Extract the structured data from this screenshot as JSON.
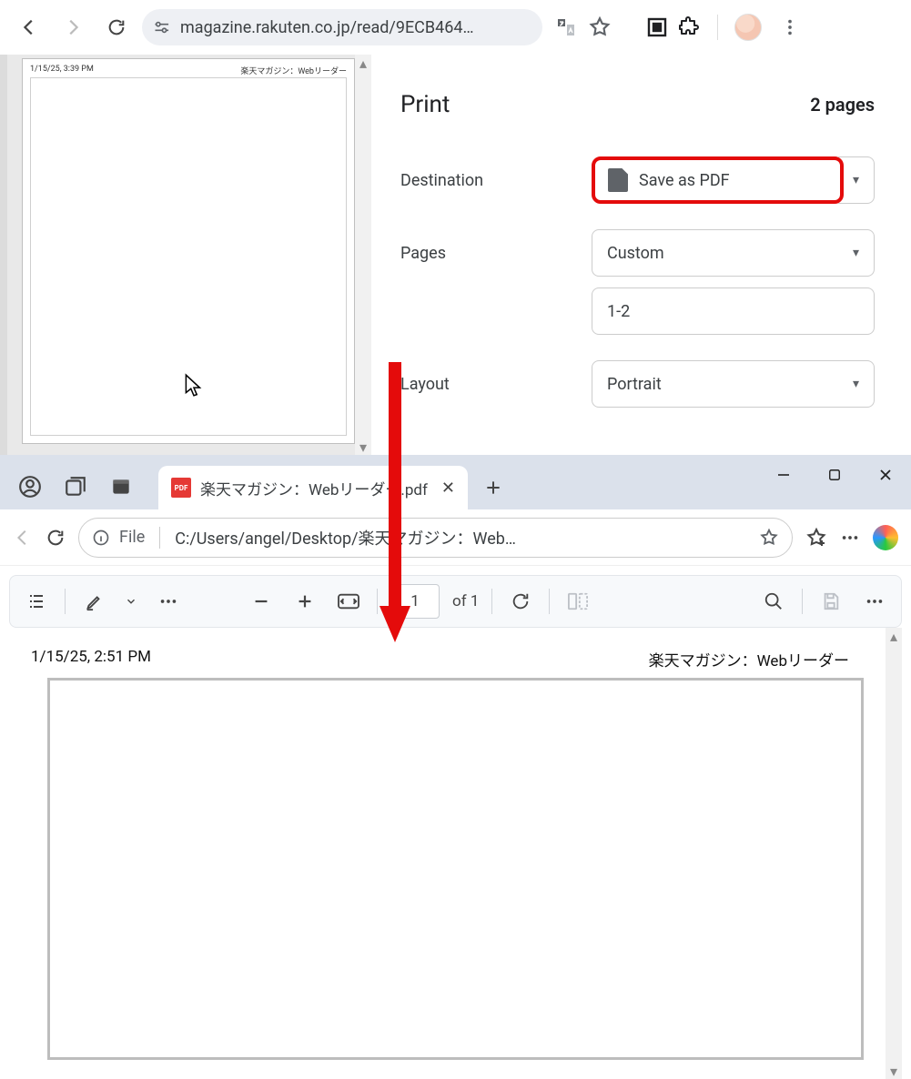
{
  "chrome": {
    "url": "magazine.rakuten.co.jp/read/9ECB464…",
    "preview": {
      "timestamp": "1/15/25, 3:39 PM",
      "title": "楽天マガジン：Webリーダー"
    },
    "print": {
      "title": "Print",
      "page_count": "2 pages",
      "destination_label": "Destination",
      "destination_value": "Save as PDF",
      "pages_label": "Pages",
      "pages_mode": "Custom",
      "pages_range": "1-2",
      "layout_label": "Layout",
      "layout_value": "Portrait"
    }
  },
  "edge": {
    "tab_title": "楽天マガジン：Webリーダー.pdf",
    "address_label": "File",
    "address_path": "C:/Users/angel/Desktop/楽天マガジン：Web…",
    "pdf": {
      "current_page": "1",
      "of_label": "of 1",
      "doc_timestamp": "1/15/25, 2:51 PM",
      "doc_title": "楽天マガジン：Webリーダー"
    }
  }
}
